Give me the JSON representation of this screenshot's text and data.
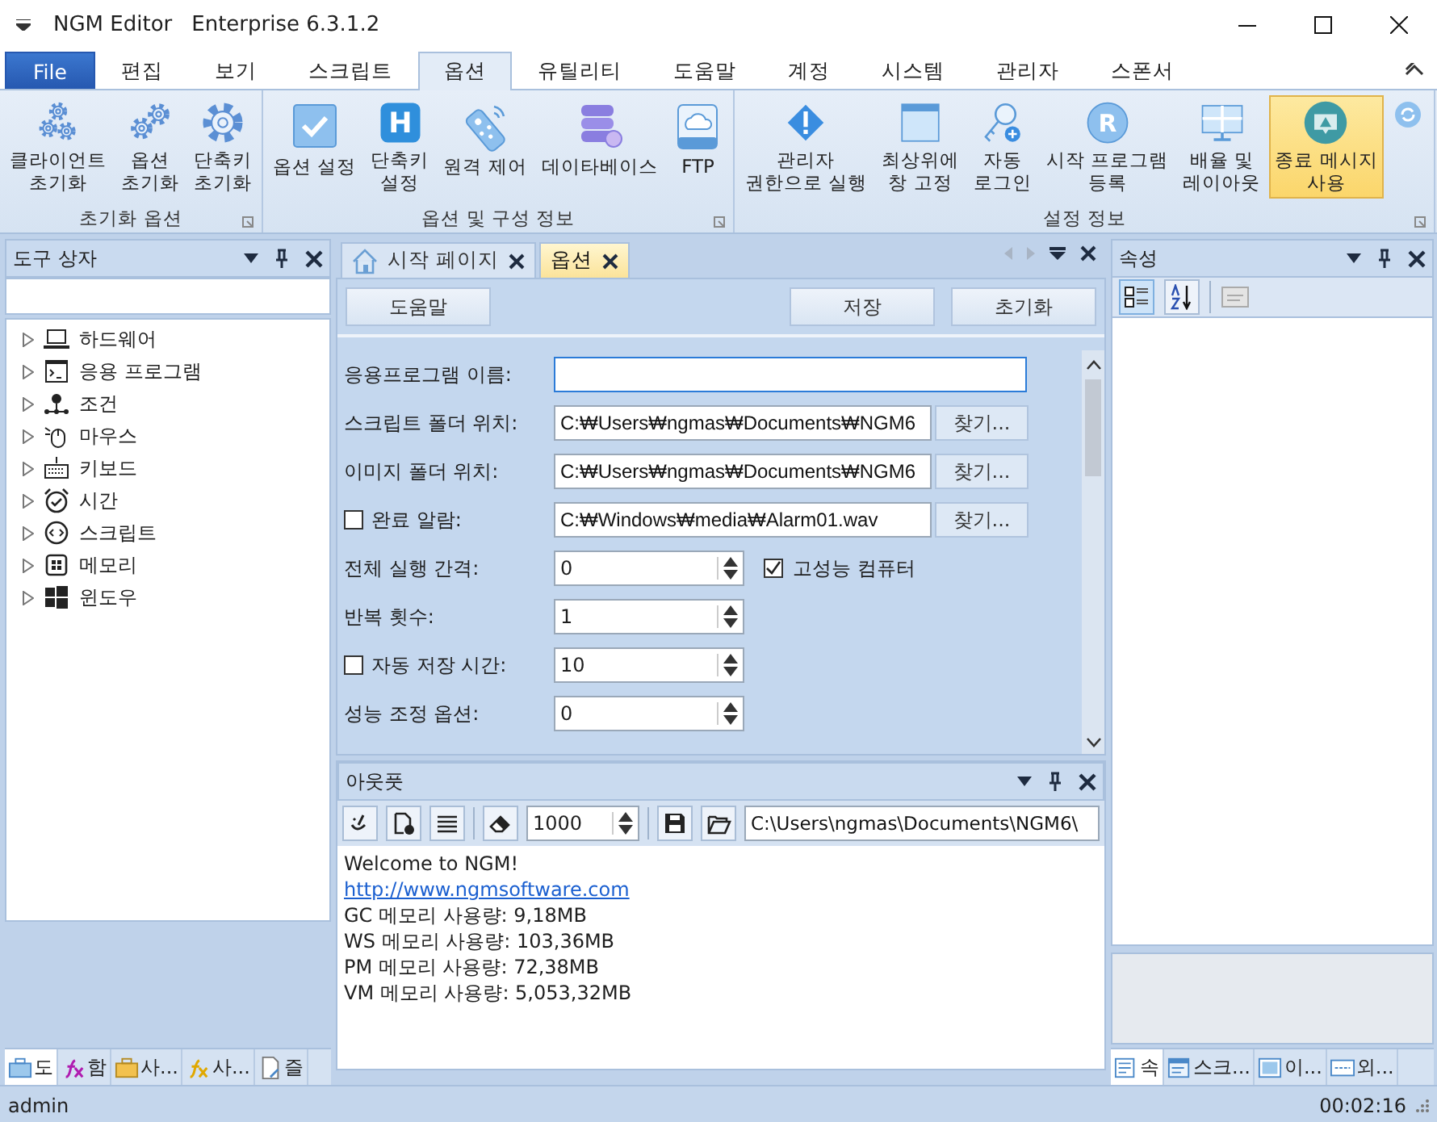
{
  "window": {
    "title": "NGM Editor",
    "edition": "Enterprise 6.3.1.2"
  },
  "ribbon": {
    "tabs": [
      {
        "label": "File",
        "kind": "file",
        "selected": false
      },
      {
        "label": "편집",
        "kind": "tab",
        "selected": false
      },
      {
        "label": "보기",
        "kind": "tab",
        "selected": false
      },
      {
        "label": "스크립트",
        "kind": "tab",
        "selected": false
      },
      {
        "label": "옵션",
        "kind": "tab",
        "selected": true
      },
      {
        "label": "유틸리티",
        "kind": "tab",
        "selected": false
      },
      {
        "label": "도움말",
        "kind": "tab",
        "selected": false
      },
      {
        "label": "계정",
        "kind": "tab",
        "selected": false
      },
      {
        "label": "시스템",
        "kind": "tab",
        "selected": false
      },
      {
        "label": "관리자",
        "kind": "tab",
        "selected": false
      },
      {
        "label": "스폰서",
        "kind": "tab",
        "selected": false
      }
    ],
    "groups": [
      {
        "title": "초기화 옵션",
        "buttons": [
          {
            "lines": [
              "클라이언트",
              "초기화"
            ],
            "selected": false
          },
          {
            "lines": [
              "옵션",
              "초기화"
            ],
            "selected": false
          },
          {
            "lines": [
              "단축키",
              "초기화"
            ],
            "selected": false
          }
        ]
      },
      {
        "title": "옵션 및 구성 정보",
        "buttons": [
          {
            "lines": [
              "옵션 설정"
            ],
            "selected": false
          },
          {
            "lines": [
              "단축키",
              "설정"
            ],
            "badge": "H",
            "selected": false
          },
          {
            "lines": [
              "원격 제어"
            ],
            "selected": false
          },
          {
            "lines": [
              "데이타베이스"
            ],
            "selected": false
          },
          {
            "lines": [
              "FTP"
            ],
            "selected": false
          }
        ]
      },
      {
        "title": "설정 정보",
        "buttons": [
          {
            "lines": [
              "관리자",
              "권한으로 실행"
            ],
            "selected": false
          },
          {
            "lines": [
              "최상위에",
              "창 고정"
            ],
            "selected": false
          },
          {
            "lines": [
              "자동",
              "로그인"
            ],
            "selected": false
          },
          {
            "lines": [
              "시작 프로그램",
              "등록"
            ],
            "badge": "R",
            "selected": false
          },
          {
            "lines": [
              "배율 및",
              "레이아웃"
            ],
            "selected": false
          },
          {
            "lines": [
              "종료 메시지",
              "사용"
            ],
            "selected": true
          }
        ]
      }
    ]
  },
  "toolbox": {
    "title": "도구 상자",
    "items": [
      {
        "label": "하드웨어",
        "expanded": false
      },
      {
        "label": "응용 프로그램",
        "expanded": false
      },
      {
        "label": "조건",
        "expanded": false
      },
      {
        "label": "마우스",
        "expanded": false
      },
      {
        "label": "키보드",
        "expanded": false
      },
      {
        "label": "시간",
        "expanded": false
      },
      {
        "label": "스크립트",
        "expanded": false
      },
      {
        "label": "메모리",
        "expanded": false
      },
      {
        "label": "윈도우",
        "expanded": false
      }
    ],
    "tabs": [
      {
        "label": "도",
        "selected": true
      },
      {
        "label": "함",
        "selected": false
      },
      {
        "label": "사...",
        "selected": false
      },
      {
        "label": "사...",
        "selected": false
      },
      {
        "label": "즐",
        "selected": false
      }
    ]
  },
  "documents": {
    "tabs": [
      {
        "label": "시작 페이지",
        "kind": "home",
        "selected": false
      },
      {
        "label": "옵션",
        "kind": "page",
        "selected": true
      }
    ],
    "buttons_left": [
      "도움말"
    ],
    "buttons_right": [
      "저장",
      "초기화"
    ],
    "rows": [
      {
        "kind": "text",
        "label": "응용프로그램 이름:",
        "value": "",
        "focused": true
      },
      {
        "kind": "path",
        "label": "스크립트 폴더 위치:",
        "value": "C:₩Users₩ngmas₩Documents₩NGM6",
        "browse": "찾기..."
      },
      {
        "kind": "path",
        "label": "이미지 폴더 위치:",
        "value": "C:₩Users₩ngmas₩Documents₩NGM6",
        "browse": "찾기..."
      },
      {
        "kind": "path",
        "label": "완료 알람:",
        "checked": false,
        "value": "C:₩Windows₩media₩Alarm01.wav",
        "browse": "찾기..."
      },
      {
        "kind": "spin",
        "label": "전체 실행 간격:",
        "value": "0",
        "option": {
          "label": "고성능 컴퓨터",
          "checked": true
        }
      },
      {
        "kind": "spin",
        "label": "반복 횟수:",
        "value": "1"
      },
      {
        "kind": "spin",
        "label": "자동 저장 시간:",
        "checked": false,
        "value": "10"
      },
      {
        "kind": "spin",
        "label": "성능 조정 옵션:",
        "value": "0"
      }
    ]
  },
  "output": {
    "title": "아웃풋",
    "count": "1000",
    "path": "C:\\Users\\ngmas\\Documents\\NGM6\\",
    "lines": [
      {
        "kind": "text",
        "text": "Welcome to NGM!"
      },
      {
        "kind": "link",
        "text": "http://www.ngmsoftware.com"
      },
      {
        "kind": "text",
        "text": "GC 메모리 사용량: 9,18MB"
      },
      {
        "kind": "text",
        "text": "WS 메모리 사용량: 103,36MB"
      },
      {
        "kind": "text",
        "text": "PM 메모리 사용량: 72,38MB"
      },
      {
        "kind": "text",
        "text": "VM 메모리 사용량: 5,053,32MB"
      }
    ]
  },
  "properties": {
    "title": "속성",
    "toolbar": [
      {
        "selected": true
      },
      {
        "selected": false
      }
    ],
    "tabs": [
      {
        "label": "속",
        "selected": true
      },
      {
        "label": "스크...",
        "selected": false
      },
      {
        "label": "이...",
        "selected": false
      },
      {
        "label": "외...",
        "selected": false
      }
    ]
  },
  "status_bar": {
    "user": "admin",
    "time": "00:02:16"
  }
}
